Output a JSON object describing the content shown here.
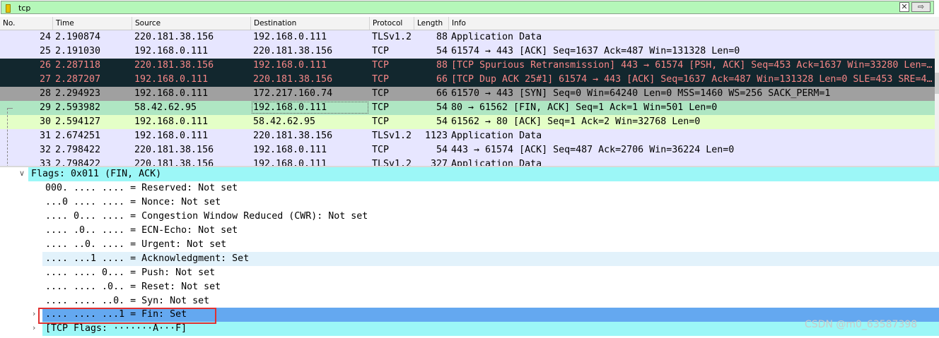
{
  "filter": {
    "value": "tcp",
    "clear_glyph": "✕",
    "apply_glyph": "⇨"
  },
  "columns": [
    "No.",
    "Time",
    "Source",
    "Destination",
    "Protocol",
    "Length",
    "Info"
  ],
  "packets": [
    {
      "no": "24",
      "time": "2.190874",
      "src": "220.181.38.156",
      "dst": "192.168.0.111",
      "proto": "TLSv1.2",
      "len": "88",
      "info": "Application Data",
      "style": "tls"
    },
    {
      "no": "25",
      "time": "2.191030",
      "src": "192.168.0.111",
      "dst": "220.181.38.156",
      "proto": "TCP",
      "len": "54",
      "info": "61574 → 443 [ACK] Seq=1637 Ack=487 Win=131328 Len=0",
      "style": "tls"
    },
    {
      "no": "26",
      "time": "2.287118",
      "src": "220.181.38.156",
      "dst": "192.168.0.111",
      "proto": "TCP",
      "len": "88",
      "info": "[TCP Spurious Retransmission] 443 → 61574 [PSH, ACK] Seq=453 Ack=1637 Win=33280 Len=…",
      "style": "bad"
    },
    {
      "no": "27",
      "time": "2.287207",
      "src": "192.168.0.111",
      "dst": "220.181.38.156",
      "proto": "TCP",
      "len": "66",
      "info": "[TCP Dup ACK 25#1] 61574 → 443 [ACK] Seq=1637 Ack=487 Win=131328 Len=0 SLE=453 SRE=4…",
      "style": "bad"
    },
    {
      "no": "28",
      "time": "2.294923",
      "src": "192.168.0.111",
      "dst": "172.217.160.74",
      "proto": "TCP",
      "len": "66",
      "info": "61570 → 443 [SYN] Seq=0 Win=64240 Len=0 MSS=1460 WS=256 SACK_PERM=1",
      "style": "syn"
    },
    {
      "no": "29",
      "time": "2.593982",
      "src": "58.42.62.95",
      "dst": "192.168.0.111",
      "proto": "TCP",
      "len": "54",
      "info": "80 → 61562 [FIN, ACK] Seq=1 Ack=1 Win=501 Len=0",
      "style": "fin"
    },
    {
      "no": "30",
      "time": "2.594127",
      "src": "192.168.0.111",
      "dst": "58.42.62.95",
      "proto": "TCP",
      "len": "54",
      "info": "61562 → 80 [ACK] Seq=1 Ack=2 Win=32768 Len=0",
      "style": "ack"
    },
    {
      "no": "31",
      "time": "2.674251",
      "src": "192.168.0.111",
      "dst": "220.181.38.156",
      "proto": "TLSv1.2",
      "len": "1123",
      "info": "Application Data",
      "style": "tls"
    },
    {
      "no": "32",
      "time": "2.798422",
      "src": "220.181.38.156",
      "dst": "192.168.0.111",
      "proto": "TCP",
      "len": "54",
      "info": "443 → 61574 [ACK] Seq=487 Ack=2706 Win=36224 Len=0",
      "style": "tls"
    }
  ],
  "partial_row": {
    "no": "33",
    "time": "2.798422",
    "src": "220.181.38.156",
    "dst": "192.168.0.111",
    "proto": "TLSv1.2",
    "len": "327",
    "info": "Application Data"
  },
  "detail": {
    "flags_header": "Flags: 0x011 (FIN, ACK)",
    "flag_lines": [
      "000. .... .... = Reserved: Not set",
      "...0 .... .... = Nonce: Not set",
      ".... 0... .... = Congestion Window Reduced (CWR): Not set",
      ".... .0.. .... = ECN-Echo: Not set",
      ".... ..0. .... = Urgent: Not set",
      ".... ...1 .... = Acknowledgment: Set",
      ".... .... 0... = Push: Not set",
      ".... .... .0.. = Reset: Not set",
      ".... .... ..0. = Syn: Not set",
      ".... .... ...1 = Fin: Set"
    ],
    "tcp_flags": "[TCP Flags: ·······A···F]",
    "expander_open": "∨",
    "expander_closed": "›"
  },
  "watermark": "CSDN @m0_63587398",
  "colors": {
    "filter_bg": "#b5f7b9",
    "tls_row": "#e7e6ff",
    "bad_row_bg": "#12272e",
    "bad_row_fg": "#f78787",
    "syn_row": "#a0a0a0",
    "fin_row": "#afe6c3",
    "ack_row": "#e4ffc7",
    "selected_detail": "#64a8f0",
    "highlight_box": "#e03030"
  }
}
